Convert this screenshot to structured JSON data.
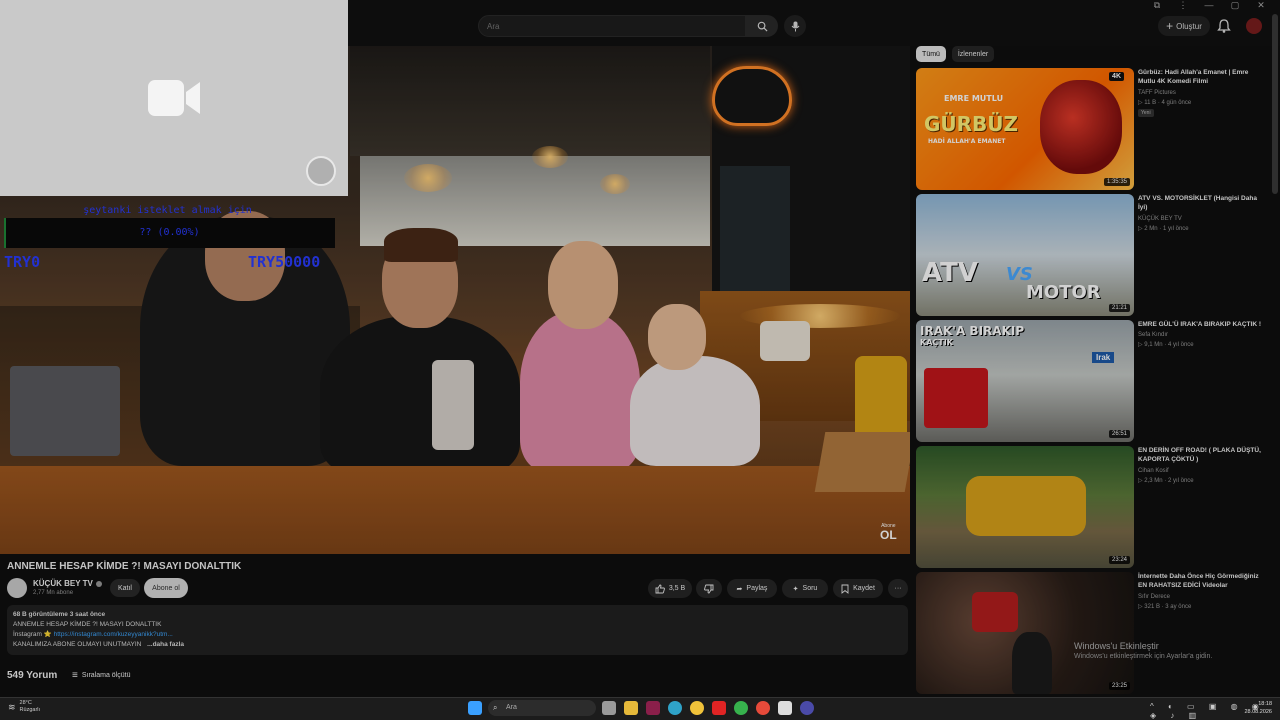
{
  "window_controls": [
    "⧉",
    "⋮",
    "—",
    "▢",
    "✕"
  ],
  "header": {
    "search_placeholder": "Ara",
    "create_label": "Oluştur"
  },
  "overlay": {
    "donate_title": "şeytanki isteklet almak için",
    "donate_amount": "?? (0.00%)",
    "min_label": "TRY0",
    "max_label": "TRY50000"
  },
  "video": {
    "watermark_small": "Abone",
    "watermark": "OL",
    "title": "ANNEMLE HESAP KİMDE ?! MASAYI DONALTTIK",
    "channel": "KÜÇÜK BEY TV",
    "subscribers": "2,77 Mn abone",
    "join_label": "Katıl",
    "subscribed_label": "Abone ol",
    "likes": "3,5 B",
    "share_label": "Paylaş",
    "ask_label": "Soru",
    "save_label": "Kaydet",
    "more_label": "···"
  },
  "description": {
    "stats": "68 B görüntüleme  3 saat önce",
    "line1": "ANNEMLE HESAP KİMDE ?! MASAYI DONALTTIK",
    "instagram_label": "İnstagram ⭐",
    "instagram_link": "https://instagram.com/kuzeyyanikk?utm...",
    "line3": "KANALIMIZA ABONE OLMAYI UNUTMAYIN",
    "more": "...daha fazla"
  },
  "comments": {
    "count": "549 Yorum",
    "sort_label": "Sıralama ölçütü"
  },
  "sidebar": {
    "chips": [
      "Tümü",
      "İzlenenler"
    ],
    "items": [
      {
        "title": "Gürbüz: Hadi Allah'a Emanet | Emre Mutlu 4K Komedi Filmi",
        "channel": "TAFF Pictures",
        "meta": "▷ 11 B  ·  4 gün önce",
        "badge": "Yeni",
        "duration": "1:35:35",
        "thumb_big": "GÜRBÜZ",
        "thumb_sub": "HADİ ALLAH'A EMANET",
        "thumb_top": "EMRE MUTLU",
        "thumb_corner": "4K"
      },
      {
        "title": "ATV VS. MOTORSİKLET (Hangisi Daha İyi)",
        "channel": "KÜÇÜK BEY TV",
        "meta": "▷ 2 Mn  ·  1 yıl önce",
        "badge": "",
        "duration": "21:21",
        "thumb_big": "ATV",
        "thumb_sub": "MOTOR",
        "thumb_top": "VS",
        "thumb_corner": ""
      },
      {
        "title": "EMRE GÜL'Ü IRAK'A BIRAKIP KAÇTIK !",
        "channel": "Sefa Kındır",
        "meta": "▷ 9,1 Mn  ·  4 yıl önce",
        "badge": "",
        "duration": "26:51",
        "thumb_big": "IRAK'A BIRAKIP",
        "thumb_sub": "KAÇTIK",
        "thumb_top": "Irak",
        "thumb_corner": ""
      },
      {
        "title": "EN DERİN OFF ROAD! ( PLAKA DÜŞTÜ, KAPORTA ÇÖKTÜ )",
        "channel": "Cihan Kosif",
        "meta": "▷ 2,3 Mn  ·  2 yıl önce",
        "badge": "",
        "duration": "23:24",
        "thumb_big": "",
        "thumb_sub": "",
        "thumb_top": "",
        "thumb_corner": ""
      },
      {
        "title": "İnternette Daha Önce Hiç Görmediğiniz EN RAHATSIZ EDİCİ Videolar",
        "channel": "Sıfır Derece",
        "meta": "▷ 321 B  ·  3 ay önce",
        "badge": "",
        "duration": "23:25",
        "thumb_big": "",
        "thumb_sub": "",
        "thumb_top": "",
        "thumb_corner": ""
      }
    ]
  },
  "windows_activation": {
    "title": "Windows'u Etkinleştir",
    "subtitle": "Windows'u etkinleştirmek için Ayarlar'a gidin."
  },
  "taskbar": {
    "temperature": "28°C",
    "weather": "Rüzgarlı",
    "search_placeholder": "Ara",
    "time": "18:18",
    "date": "28.08.2026"
  },
  "colors": {
    "background": "#0f0f0f",
    "overlay_text": "#2a3cff",
    "link": "#3ea6ff"
  }
}
